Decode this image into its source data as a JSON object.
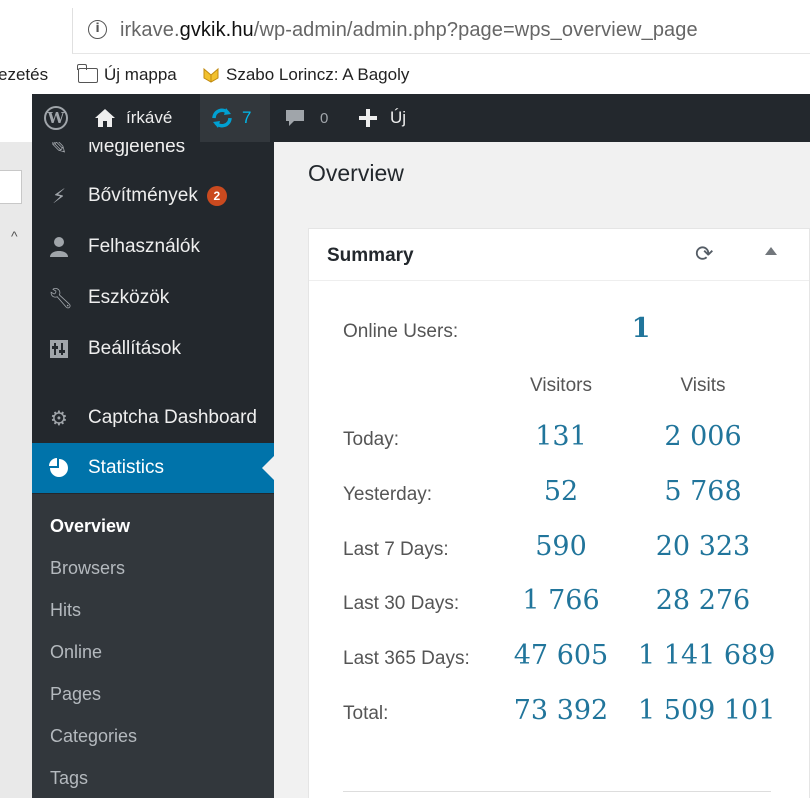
{
  "browser": {
    "url_prefix": "irkave.",
    "url_domain": "gvkik.hu",
    "url_path": "/wp-admin/admin.php?page=wps_overview_page"
  },
  "bookmarks": [
    {
      "label": "ezetés",
      "icon": "none"
    },
    {
      "label": "Új mappa",
      "icon": "folder-icon"
    },
    {
      "label": "Szabo Lorincz: A Bagoly",
      "icon": "bookmark-favicon"
    }
  ],
  "adminbar": {
    "site_name": "írkávé",
    "updates_count": "7",
    "comments_count": "0",
    "new_label": "Új"
  },
  "menu": {
    "items": [
      {
        "label": "Megjelenés",
        "icon": "brush-icon"
      },
      {
        "label": "Bővítmények",
        "icon": "plug-icon",
        "badge": "2"
      },
      {
        "label": "Felhasználók",
        "icon": "user-icon"
      },
      {
        "label": "Eszközök",
        "icon": "wrench-icon"
      },
      {
        "label": "Beállítások",
        "icon": "settings-icon"
      },
      {
        "label": "Captcha Dashboard",
        "icon": "gear-icon"
      },
      {
        "label": "Statistics",
        "icon": "pie-chart-icon",
        "active": true
      }
    ],
    "submenu": [
      "Overview",
      "Browsers",
      "Hits",
      "Online",
      "Pages",
      "Categories",
      "Tags"
    ]
  },
  "page": {
    "title": "Overview",
    "summary": {
      "title": "Summary",
      "online_label": "Online Users:",
      "online_value": "1",
      "col_visitors": "Visitors",
      "col_visits": "Visits",
      "rows": [
        {
          "label": "Today:",
          "visitors": "131",
          "visits": "2 006"
        },
        {
          "label": "Yesterday:",
          "visitors": "52",
          "visits": "5 768"
        },
        {
          "label": "Last 7 Days:",
          "visitors": "590",
          "visits": "20 323"
        },
        {
          "label": "Last 30 Days:",
          "visitors": "1 766",
          "visits": "28 276"
        },
        {
          "label": "Last 365 Days:",
          "visitors": "47 605",
          "visits": "1 141 689"
        },
        {
          "label": "Total:",
          "visitors": "73 392",
          "visits": "1 509 101"
        }
      ]
    }
  },
  "colors": {
    "admin_dark": "#23282d",
    "accent_blue": "#0073aa",
    "value_blue": "#21759b",
    "badge_orange": "#ca4a1f",
    "update_icon_blue": "#00a0d2"
  }
}
